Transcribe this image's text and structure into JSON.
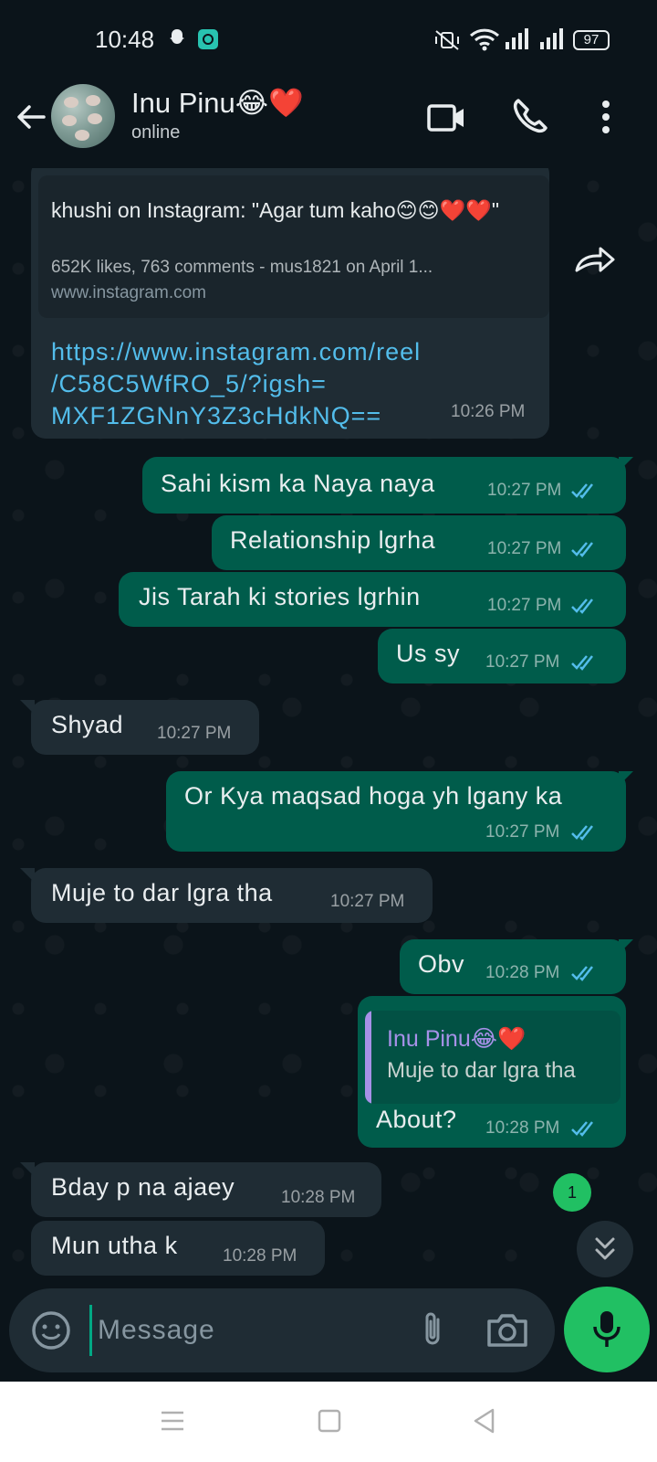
{
  "status_bar": {
    "time": "10:48",
    "battery": "97"
  },
  "header": {
    "contact_name": "Inu Pinu😂❤️",
    "contact_status": "online",
    "icons": [
      "back-arrow-icon",
      "video-call-icon",
      "voice-call-icon",
      "more-options-icon"
    ]
  },
  "link_message": {
    "preview_title": "khushi on Instagram: \"Agar tum kaho😊😊❤️❤️\"",
    "preview_meta": "652K likes, 763 comments - mus1821 on April 1...",
    "preview_domain": "www.instagram.com",
    "url_line1": "https://www.instagram.com/reel",
    "url_line2": "/C58C5WfRO_5/?igsh=",
    "url_line3": "MXF1ZGNnY3Z3cHdkNQ==",
    "time": "10:26 PM"
  },
  "messages": [
    {
      "direction": "out",
      "text": "Sahi kism ka Naya naya",
      "time": "10:27 PM"
    },
    {
      "direction": "out",
      "text": "Relationship lgrha",
      "time": "10:27 PM"
    },
    {
      "direction": "out",
      "text": "Jis Tarah ki stories lgrhin",
      "time": "10:27 PM"
    },
    {
      "direction": "out",
      "text": "Us sy",
      "time": "10:27 PM"
    },
    {
      "direction": "in",
      "text": "Shyad",
      "time": "10:27 PM"
    },
    {
      "direction": "out",
      "text": "Or Kya maqsad hoga yh lgany ka",
      "time": "10:27 PM"
    },
    {
      "direction": "in",
      "text": "Muje to dar lgra tha",
      "time": "10:27 PM"
    },
    {
      "direction": "out",
      "text": "Obv",
      "time": "10:28 PM"
    },
    {
      "direction": "out",
      "text": "About?",
      "time": "10:28 PM"
    },
    {
      "direction": "in",
      "text": "Bday p na ajaey",
      "time": "10:28 PM"
    },
    {
      "direction": "in",
      "text": "Mun utha k",
      "time": "10:28 PM"
    }
  ],
  "quoted_reply": {
    "name": "Inu Pinu😂❤️",
    "text": "Muje to dar lgra tha"
  },
  "unread_count": "1",
  "composer": {
    "placeholder": "Message"
  },
  "colors": {
    "background": "#0b141a",
    "incoming_bubble": "#1f2c34",
    "outgoing_bubble": "#005c4b",
    "accent_green": "#21c063",
    "link_blue": "#53bdeb",
    "read_ticks": "#53bdeb"
  }
}
